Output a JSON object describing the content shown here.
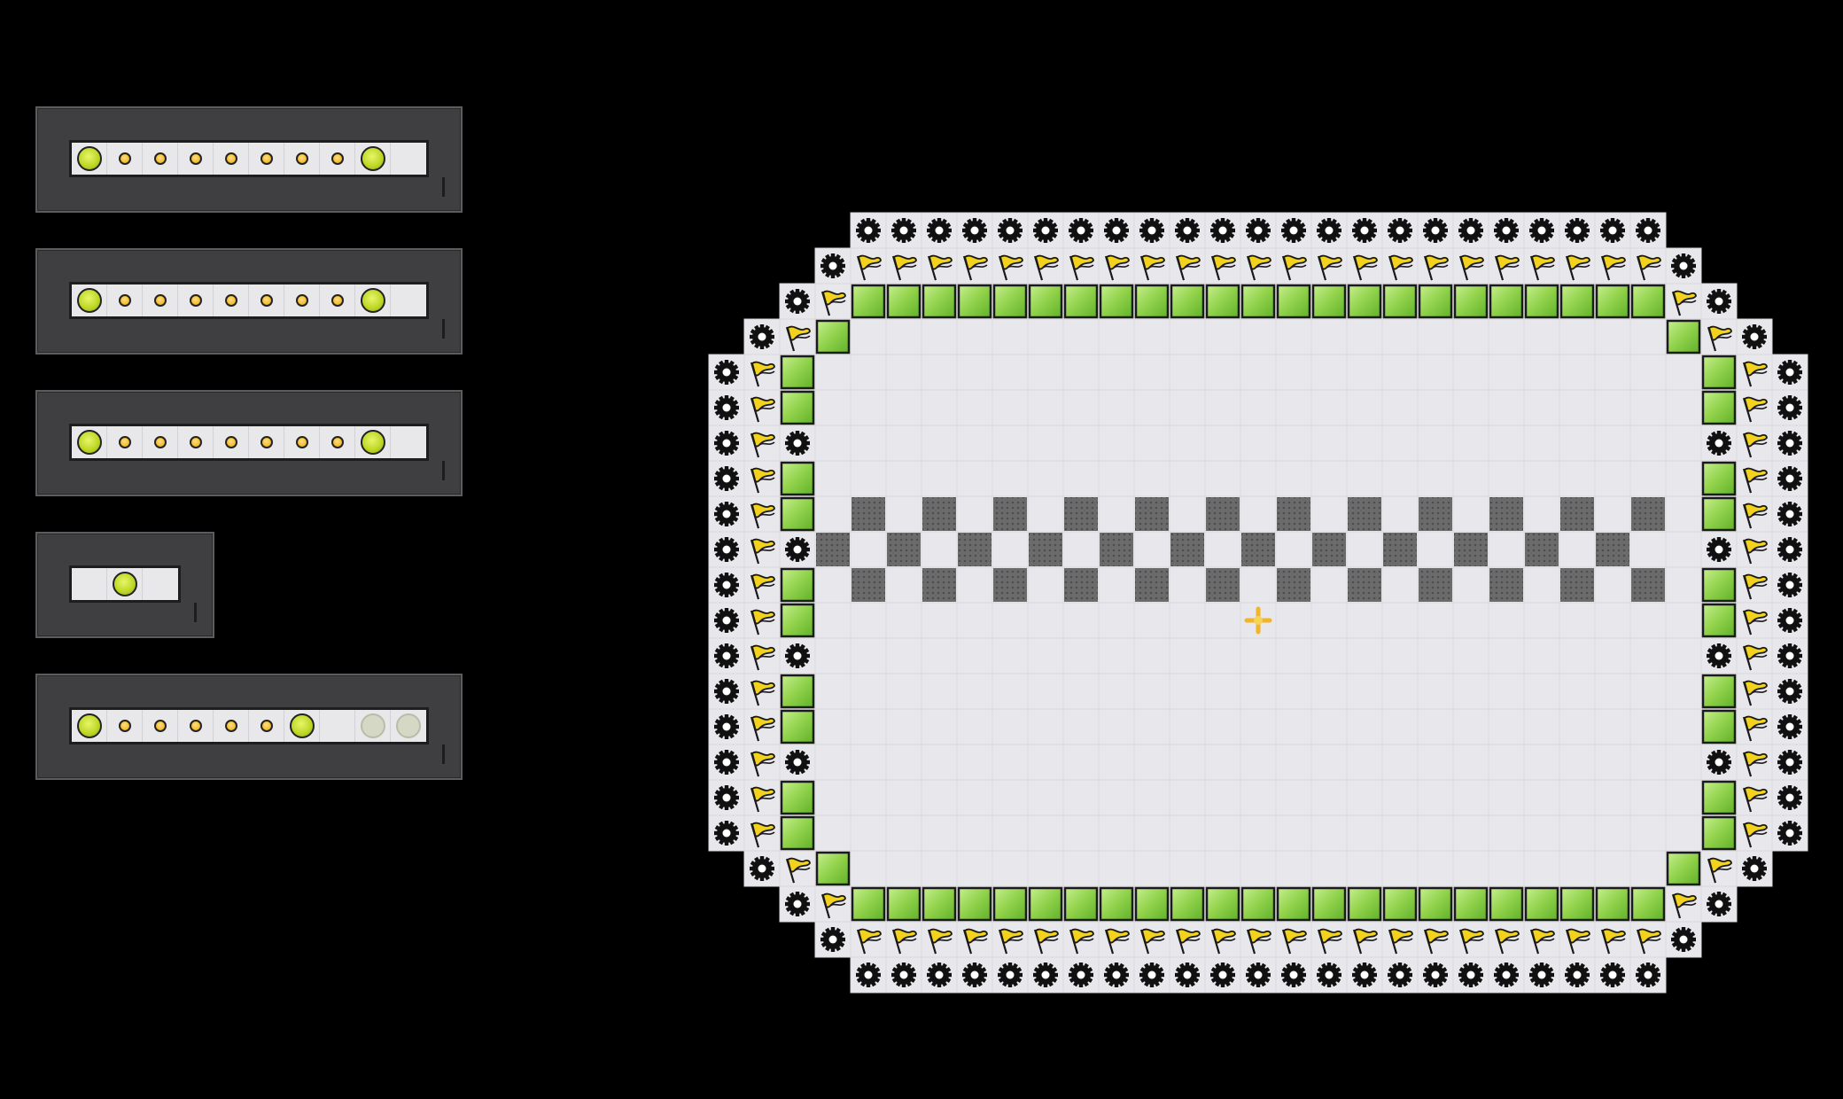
{
  "colors": {
    "background": "#000000",
    "floor": "#e8e8ec",
    "pink_check": "#f0c9bf",
    "block": "#6b6b6b",
    "green_box": "#8fd14a",
    "flag": "#f2d21c",
    "level_dot": "#cfe63a"
  },
  "level_selector": {
    "rows": [
      {
        "slots": [
          "big",
          "small",
          "small",
          "small",
          "small",
          "small",
          "small",
          "small",
          "big",
          "empty"
        ]
      },
      {
        "slots": [
          "big",
          "small",
          "small",
          "small",
          "small",
          "small",
          "small",
          "small",
          "big",
          "empty"
        ]
      },
      {
        "slots": [
          "big",
          "small",
          "small",
          "small",
          "small",
          "small",
          "small",
          "small",
          "big",
          "empty"
        ]
      },
      {
        "slots": [
          "empty",
          "big",
          "empty"
        ]
      },
      {
        "slots": [
          "big",
          "small",
          "small",
          "small",
          "small",
          "small",
          "big",
          "empty",
          "dim",
          "dim"
        ]
      }
    ]
  },
  "board": {
    "icons": {
      "gear": "gear-icon",
      "flag": "flag-icon",
      "box": "green-block-icon",
      "block": "grey-stone-icon",
      "player": "crosshair-player-icon"
    }
  }
}
